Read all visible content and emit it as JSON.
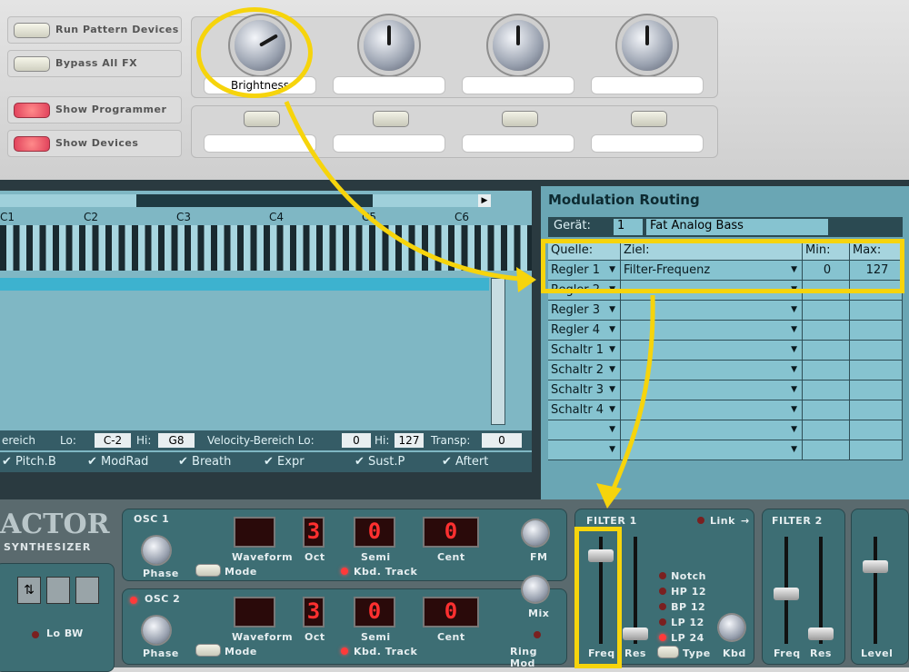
{
  "side_buttons": [
    {
      "label": "Run Pattern Devices"
    },
    {
      "label": "Bypass All FX"
    },
    {
      "label": "Show Programmer"
    },
    {
      "label": "Show Devices"
    }
  ],
  "knobs": [
    {
      "label": "Brightness"
    },
    {
      "label": ""
    },
    {
      "label": ""
    },
    {
      "label": ""
    }
  ],
  "keyboard": {
    "labels": [
      "C1",
      "C2",
      "C3",
      "C4",
      "C5",
      "C6"
    ]
  },
  "seq_bottom": {
    "range_label": "ereich",
    "lo_label": "Lo:",
    "lo": "C-2",
    "hi_label": "Hi:",
    "hi": "G8",
    "vel_label": "Velocity-Bereich Lo:",
    "vel_lo": "0",
    "vel_hi_label": "Hi:",
    "vel_hi": "127",
    "transp_label": "Transp:",
    "transp": "0"
  },
  "seq_checks": [
    "Pitch.B",
    "ModRad",
    "Breath",
    "Expr",
    "Sust.P",
    "Aftert"
  ],
  "routing": {
    "title": "Modulation Routing",
    "device_label": "Gerät:",
    "device_num": "1",
    "device_name": "Fat Analog Bass",
    "headers": {
      "source": "Quelle:",
      "target": "Ziel:",
      "min": "Min:",
      "max": "Max:"
    },
    "rows": [
      {
        "source": "Regler 1",
        "target": "Filter-Frequenz",
        "min": "0",
        "max": "127"
      },
      {
        "source": "Regler 2",
        "target": "",
        "min": "",
        "max": ""
      },
      {
        "source": "Regler 3",
        "target": "",
        "min": "",
        "max": ""
      },
      {
        "source": "Regler 4",
        "target": "",
        "min": "",
        "max": ""
      },
      {
        "source": "Schaltr 1",
        "target": "",
        "min": "",
        "max": ""
      },
      {
        "source": "Schaltr 2",
        "target": "",
        "min": "",
        "max": ""
      },
      {
        "source": "Schaltr 3",
        "target": "",
        "min": "",
        "max": ""
      },
      {
        "source": "Schaltr 4",
        "target": "",
        "min": "",
        "max": ""
      },
      {
        "source": "",
        "target": "",
        "min": "",
        "max": ""
      },
      {
        "source": "",
        "target": "",
        "min": "",
        "max": ""
      }
    ]
  },
  "synth": {
    "brand": "ACTOR",
    "brand_sub": "SYNTHESIZER",
    "osc1": {
      "title": "OSC 1",
      "phase": "Phase",
      "mode": "Mode",
      "waveform": "Waveform",
      "oct": "Oct",
      "semi": "Semi",
      "cent": "Cent",
      "kbd": "Kbd. Track",
      "fm": "FM",
      "oct_val": "3",
      "semi_val": "0",
      "cent_val": "0"
    },
    "osc2": {
      "title": "OSC 2",
      "phase": "Phase",
      "mode": "Mode",
      "waveform": "Waveform",
      "oct": "Oct",
      "semi": "Semi",
      "cent": "Cent",
      "kbd": "Kbd. Track",
      "mix": "Mix",
      "ring": "Ring Mod",
      "oct_val": "3",
      "semi_val": "0",
      "cent_val": "0"
    },
    "filter1": {
      "title": "FILTER 1",
      "freq": "Freq",
      "res": "Res",
      "types": [
        "Notch",
        "HP 12",
        "BP 12",
        "LP 12",
        "LP 24"
      ],
      "type_label": "Type",
      "kbd": "Kbd"
    },
    "link": "Link",
    "filter2": {
      "title": "FILTER 2",
      "freq": "Freq",
      "res": "Res"
    },
    "level": "Level",
    "lo_bw": "Lo BW"
  }
}
